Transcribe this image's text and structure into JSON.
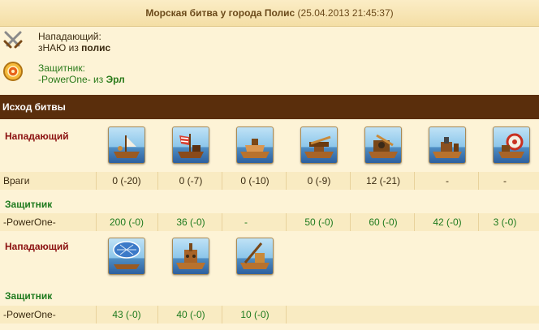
{
  "header": {
    "title": "Морская битва у города Полис",
    "date": "(25.04.2013 21:45:37)"
  },
  "attacker": {
    "role": "Нападающий:",
    "player": "зНАЮ",
    "from": " из ",
    "city": "полис",
    "icon": "crossed-swords-icon"
  },
  "defender": {
    "role": "Защитник:",
    "player": "-PowerOne-",
    "from": " из ",
    "city": "Эрл",
    "icon": "shield-icon"
  },
  "section_title": "Исход битвы",
  "groups": [
    {
      "attacker_label": "Нападающий",
      "units": [
        "ram-ship-icon",
        "fire-ship-icon",
        "paddle-ship-icon",
        "ballista-ship-icon",
        "catapult-ship-icon",
        "mortar-ship-icon",
        "diving-boat-icon"
      ],
      "attacker_row": {
        "name": "Враги",
        "values": [
          "0 (-20)",
          "0 (-7)",
          "0 (-10)",
          "0 (-9)",
          "12 (-21)",
          "-",
          "-"
        ]
      },
      "defender_label": "Защитник",
      "defender_row": {
        "name": "-PowerOne-",
        "values": [
          "200 (-0)",
          "36 (-0)",
          "-",
          "50 (-0)",
          "60 (-0)",
          "42 (-0)",
          "3 (-0)"
        ]
      }
    },
    {
      "attacker_label": "Нападающий",
      "units": [
        "balloon-carrier-icon",
        "rocket-ship-icon",
        "tender-icon"
      ],
      "defender_label": "Защитник",
      "defender_row": {
        "name": "-PowerOne-",
        "values": [
          "43 (-0)",
          "40 (-0)",
          "10 (-0)"
        ]
      }
    }
  ]
}
